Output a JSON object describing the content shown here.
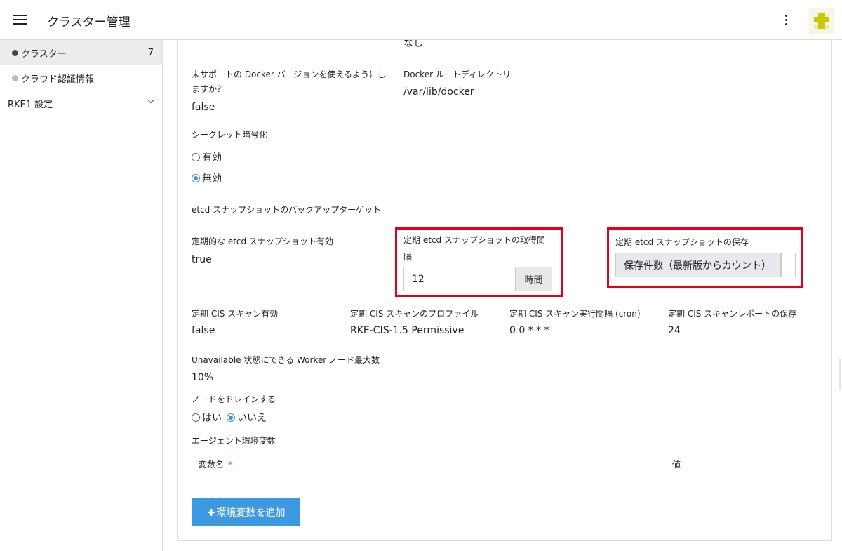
{
  "header": {
    "title": "クラスター管理"
  },
  "sidebar": {
    "items": [
      {
        "label": "クラスター",
        "count": "7",
        "dot_color": "#444444"
      },
      {
        "label": "クラウド認証情報",
        "dot_color": "#bbbbbb"
      },
      {
        "label": "RKE1 設定"
      }
    ]
  },
  "form": {
    "partial_top": {
      "left": "false",
      "right": "なし"
    },
    "docker_unsupported": {
      "label_line1": "未サポートの Docker バージョンを使えるようにし",
      "label_line2": "ますか？",
      "value": "false"
    },
    "docker_root": {
      "label": "Docker ルートディレクトリ",
      "value": "/var/lib/docker"
    },
    "secret_encryption": {
      "label": "シークレット暗号化",
      "options": [
        "有効",
        "無効"
      ],
      "selected": "無効"
    },
    "etcd_target": {
      "label": "etcd スナップショットのバックアップターゲット"
    },
    "etcd_periodic": {
      "label": "定期的な etcd スナップショット有効",
      "value": "true"
    },
    "etcd_interval": {
      "label_line1": "定期 etcd スナップショットの取得間",
      "label_line2": "隔",
      "value": "12",
      "unit": "時間"
    },
    "etcd_retention": {
      "label": "定期 etcd スナップショットの保存",
      "value": "保存件数（最新版からカウント）"
    },
    "cis_enabled": {
      "label": "定期 CIS スキャン有効",
      "value": "false"
    },
    "cis_profile": {
      "label": "定期 CIS スキャンのプロファイル",
      "value": "RKE-CIS-1.5 Permissive"
    },
    "cis_interval": {
      "label": "定期 CIS スキャン実行間隔 (cron)",
      "value": "0 0 * * *"
    },
    "cis_retention": {
      "label": "定期 CIS スキャンレポートの保存",
      "value": "24"
    },
    "unavailable_workers": {
      "label": "Unavailable 状態にできる Worker ノード最大数",
      "value": "10%"
    },
    "drain_nodes": {
      "label": "ノードをドレインする",
      "options": [
        "はい",
        "いいえ"
      ],
      "selected": "いいえ"
    },
    "agent_env": {
      "label": "エージェント環境変数",
      "col_name": "変数名",
      "required_mark": "*",
      "col_value": "値",
      "add_button": "環境変数を追加"
    }
  },
  "colors": {
    "highlight": "#e0001b",
    "accent": "#3d9ae0"
  }
}
